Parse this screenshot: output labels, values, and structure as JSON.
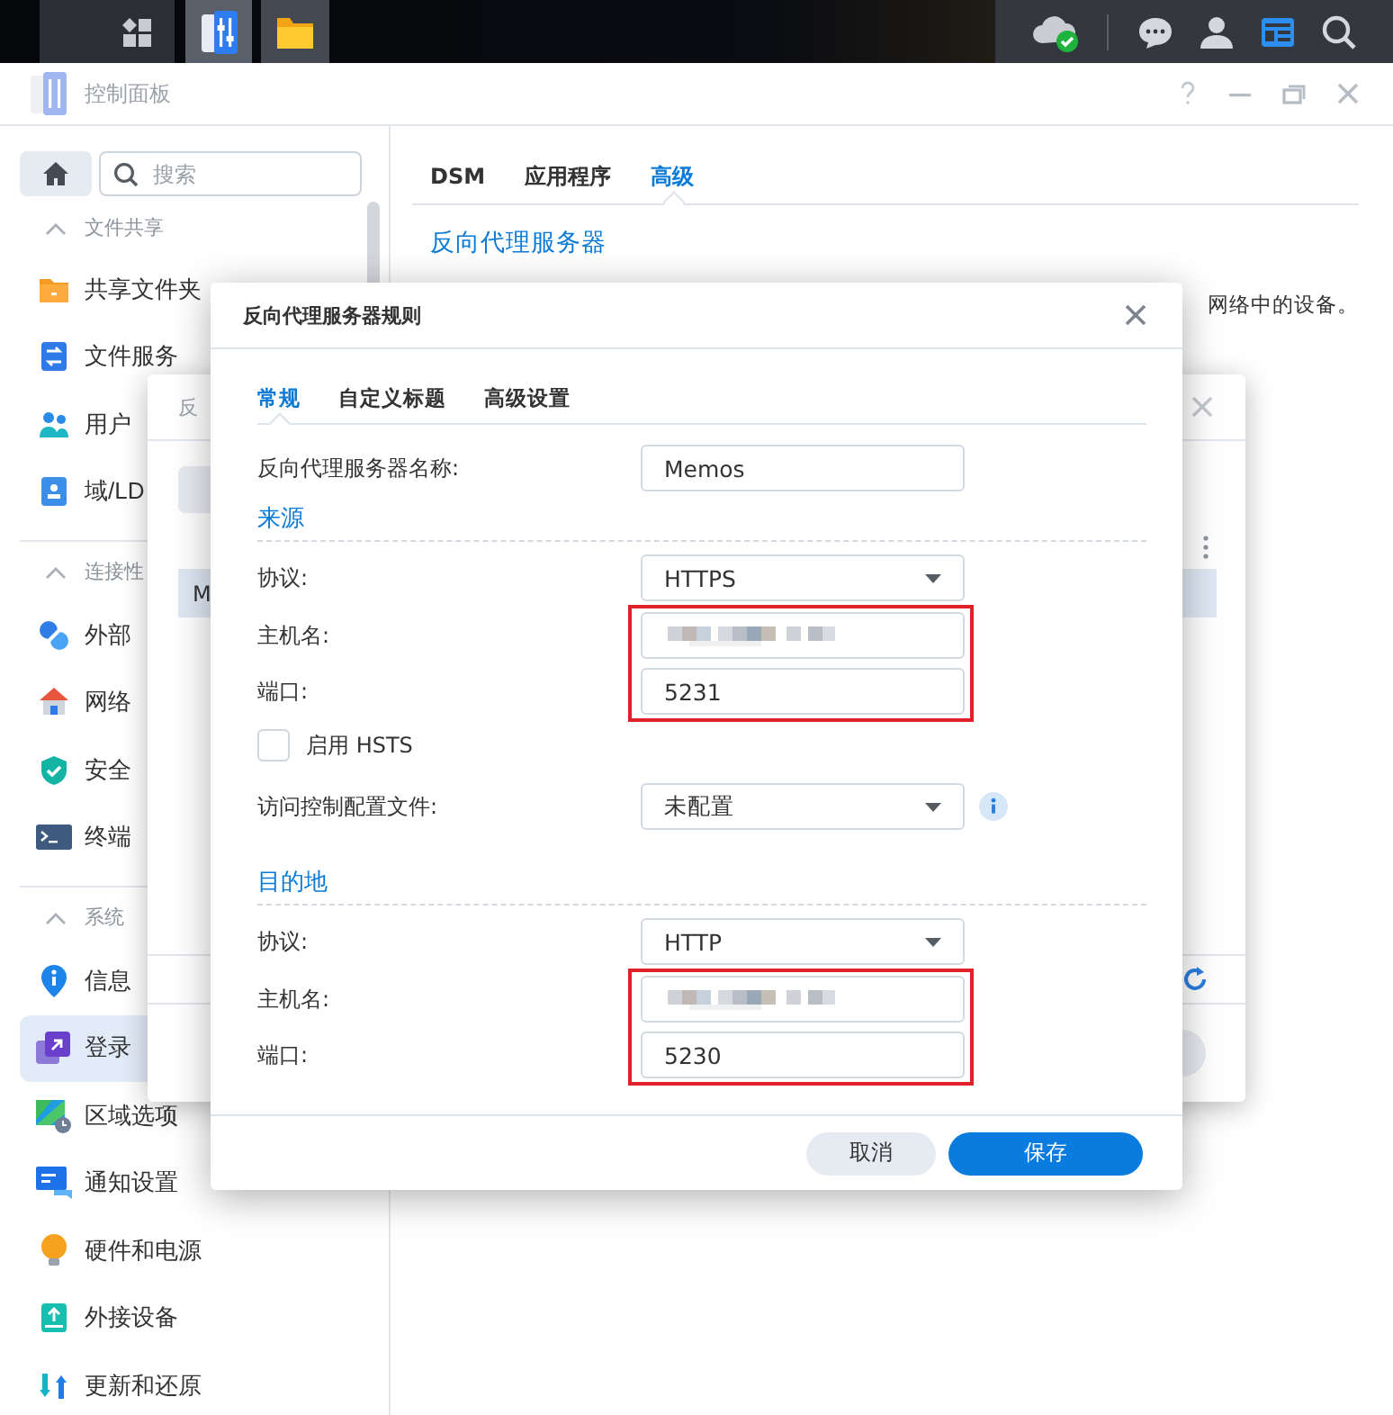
{
  "taskbar": {
    "apps": [
      {
        "kind": "main-menu",
        "selected": false
      },
      {
        "kind": "control-panel",
        "selected": true
      },
      {
        "kind": "file-station",
        "selected": false
      }
    ]
  },
  "window": {
    "title": "控制面板"
  },
  "sidebar": {
    "search": {
      "placeholder": "搜索"
    },
    "sections": [
      {
        "title": "文件共享",
        "expanded": true,
        "items": [
          {
            "kind": "folder",
            "label": "共享文件夹",
            "selected": false
          },
          {
            "kind": "file-services",
            "label": "文件服务",
            "selected": false
          },
          {
            "kind": "users",
            "label": "用户",
            "selected": false
          },
          {
            "kind": "domain",
            "label": "域/LD",
            "selected": false
          }
        ]
      },
      {
        "title": "连接性",
        "expanded": true,
        "items": [
          {
            "kind": "external",
            "label": "外部",
            "selected": false
          },
          {
            "kind": "network",
            "label": "网络",
            "selected": false
          },
          {
            "kind": "security",
            "label": "安全",
            "selected": false
          },
          {
            "kind": "terminal",
            "label": "终端",
            "selected": false
          }
        ]
      },
      {
        "title": "系统",
        "expanded": true,
        "items": [
          {
            "kind": "info",
            "label": "信息",
            "selected": false
          },
          {
            "kind": "login",
            "label": "登录",
            "selected": true
          },
          {
            "kind": "region",
            "label": "区域选项",
            "selected": false
          },
          {
            "kind": "notification",
            "label": "通知设置",
            "selected": false
          },
          {
            "kind": "hardware",
            "label": "硬件和电源",
            "selected": false
          },
          {
            "kind": "devices",
            "label": "外接设备",
            "selected": false
          },
          {
            "kind": "update",
            "label": "更新和还原",
            "selected": false
          }
        ]
      }
    ]
  },
  "content": {
    "tabs": [
      {
        "label": "DSM",
        "selected": false
      },
      {
        "label": "应用程序",
        "selected": false
      },
      {
        "label": "高级",
        "selected": true
      }
    ],
    "heading": "反向代理服务器",
    "description": "网络中的设备。"
  },
  "back_dialog": {
    "title": "反",
    "rows": [
      {
        "cell": "M",
        "selected": true
      }
    ]
  },
  "dialog": {
    "title": "反向代理服务器规则",
    "tabs": [
      {
        "label": "常规",
        "selected": true
      },
      {
        "label": "自定义标题",
        "selected": false
      },
      {
        "label": "高级设置",
        "selected": false
      }
    ],
    "name_row": {
      "label": "反向代理服务器名称:",
      "value": "Memos"
    },
    "sections": [
      {
        "title": "来源",
        "rows": [
          {
            "kind": "select",
            "label": "协议:",
            "value": "HTTPS",
            "highlighted": false
          },
          {
            "kind": "blurred",
            "label": "主机名:",
            "highlighted": true
          },
          {
            "kind": "text",
            "label": "端口:",
            "value": "5231",
            "highlighted": true
          },
          {
            "kind": "checkbox",
            "label": "启用 HSTS",
            "checked": false,
            "highlighted": false
          },
          {
            "kind": "select",
            "label": "访问控制配置文件:",
            "value": "未配置",
            "info": true,
            "highlighted": false
          }
        ]
      },
      {
        "title": "目的地",
        "rows": [
          {
            "kind": "select",
            "label": "协议:",
            "value": "HTTP",
            "highlighted": false
          },
          {
            "kind": "blurred",
            "label": "主机名:",
            "highlighted": true
          },
          {
            "kind": "text",
            "label": "端口:",
            "value": "5230",
            "highlighted": true
          }
        ]
      }
    ],
    "buttons": [
      {
        "label": "取消",
        "primary": false
      },
      {
        "label": "保存",
        "primary": true
      }
    ]
  }
}
